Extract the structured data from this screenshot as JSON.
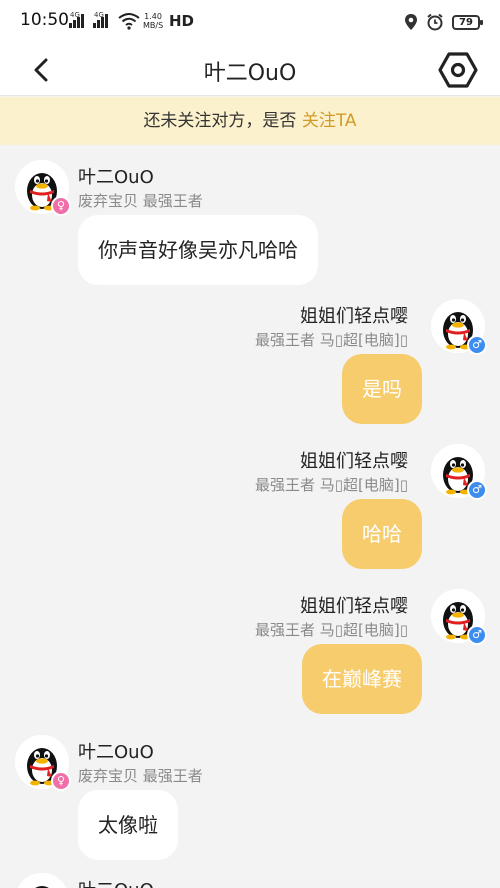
{
  "status_bar": {
    "time": "10:50",
    "net1": "4G",
    "net2": "4G",
    "speed_value": "1.40",
    "speed_unit": "MB/S",
    "hd": "HD",
    "battery": "79"
  },
  "header": {
    "title": "叶二OuO",
    "back_icon": "chevron-left-icon",
    "settings_icon": "hexagon-settings-icon"
  },
  "banner": {
    "text": "还未关注对方，是否",
    "follow_label": "关注TA",
    "background": "#fbf1cc",
    "follow_color": "#d29a2a"
  },
  "colors": {
    "outgoing_bubble": "#f6cc6c",
    "incoming_bubble": "#ffffff",
    "female_badge": "#f06fa8",
    "male_badge": "#3d8df0"
  },
  "messages": [
    {
      "direction": "in",
      "name": "叶二OuO",
      "tags": "废弃宝贝 最强王者",
      "text": "你声音好像吴亦凡哈哈",
      "gender": "♀"
    },
    {
      "direction": "out",
      "name": "姐姐们轻点嘤",
      "tags": "最强王者 马▯超[电脑]▯",
      "text": "是吗",
      "gender": "♂"
    },
    {
      "direction": "out",
      "name": "姐姐们轻点嘤",
      "tags": "最强王者 马▯超[电脑]▯",
      "text": "哈哈",
      "gender": "♂"
    },
    {
      "direction": "out",
      "name": "姐姐们轻点嘤",
      "tags": "最强王者 马▯超[电脑]▯",
      "text": "在巅峰赛",
      "gender": "♂"
    },
    {
      "direction": "in",
      "name": "叶二OuO",
      "tags": "废弃宝贝 最强王者",
      "text": "太像啦",
      "gender": "♀"
    },
    {
      "direction": "in",
      "name": "叶二OuO",
      "tags": "",
      "text": "",
      "gender": ""
    }
  ]
}
